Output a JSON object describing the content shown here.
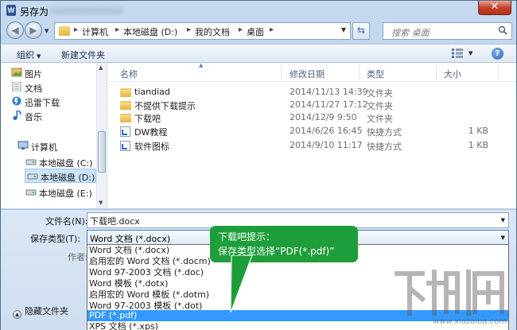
{
  "window": {
    "title": "另存为",
    "close_glyph": "✕",
    "app_icon_letter": "W"
  },
  "nav": {
    "breadcrumbs": [
      "计算机",
      "本地磁盘 (D:)",
      "我的文档",
      "桌面"
    ],
    "search_placeholder": "搜索 桌面"
  },
  "toolbar": {
    "organize_label": "组织",
    "new_folder_label": "新建文件夹",
    "help_glyph": "?"
  },
  "sidebar": {
    "items": [
      {
        "label": "图片",
        "icon": "pictures-icon"
      },
      {
        "label": "文档",
        "icon": "documents-icon"
      },
      {
        "label": "迅雷下载",
        "icon": "thunder-download-icon"
      },
      {
        "label": "音乐",
        "icon": "music-icon"
      },
      {
        "label": "计算机",
        "icon": "computer-icon"
      },
      {
        "label": "本地磁盘 (C:)",
        "icon": "drive-icon"
      },
      {
        "label": "本地磁盘 (D:)",
        "icon": "drive-icon",
        "selected": true
      },
      {
        "label": "本地磁盘 (E:)",
        "icon": "drive-icon"
      }
    ]
  },
  "files": {
    "columns": [
      "名称",
      "修改日期",
      "类型",
      "大小"
    ],
    "rows": [
      {
        "name": "tiandiad",
        "date": "2014/11/13 14:39",
        "type": "文件夹",
        "size": "",
        "icon": "folder-icon"
      },
      {
        "name": "不提供下载提示",
        "date": "2014/11/27 17:12",
        "type": "文件夹",
        "size": "",
        "icon": "folder-icon"
      },
      {
        "name": "下载吧",
        "date": "2014/12/9 9:50",
        "type": "文件夹",
        "size": "",
        "icon": "folder-icon"
      },
      {
        "name": "DW教程",
        "date": "2014/6/26 16:45",
        "type": "快捷方式",
        "size": "1 KB",
        "icon": "shortcut-icon"
      },
      {
        "name": "软件图标",
        "date": "2014/9/10 11:17",
        "type": "快捷方式",
        "size": "1 KB",
        "icon": "shortcut-icon"
      }
    ]
  },
  "form": {
    "filename_label": "文件名(N):",
    "filename_value": "下载吧.docx",
    "filetype_label": "保存类型(T):",
    "filetype_value": "Word 文档 (*.docx)",
    "author_label": "作者:"
  },
  "dropdown": {
    "options": [
      "Word 文档 (*.docx)",
      "启用宏的 Word 文档 (*.docm)",
      "Word 97-2003 文档 (*.doc)",
      "Word 模板 (*.dotx)",
      "启用宏的 Word 模板 (*.dotm)",
      "Word 97-2003 模板 (*.dot)",
      "PDF (*.pdf)",
      "XPS 文档 (*.xps)"
    ],
    "selected_index": 6
  },
  "footer": {
    "hide_folders_label": "隐藏文件夹"
  },
  "callout": {
    "line1": "下载吧提示：",
    "line2": "保存类型选择“PDF(*.pdf)”",
    "color": "#1e9e3a"
  },
  "watermark": {
    "text": "www.xiazaiba.com"
  },
  "colors": {
    "selection": "#3399ff",
    "accent_border": "#3a7fd6"
  }
}
